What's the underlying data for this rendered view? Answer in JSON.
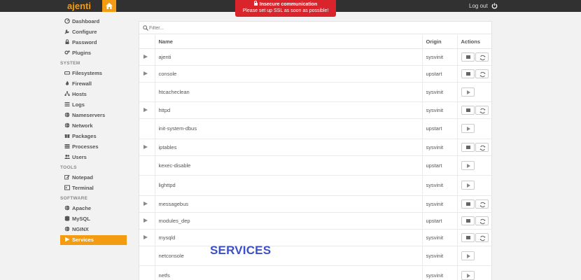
{
  "app": {
    "brand": "ajenti",
    "logout_label": "Log out"
  },
  "alert": {
    "title": "Insecure communication",
    "message": "Please set up SSL as soon as possible!"
  },
  "sidebar": {
    "top_items": [
      {
        "label": "Dashboard",
        "icon": "dashboard-icon"
      },
      {
        "label": "Configure",
        "icon": "wrench-icon"
      },
      {
        "label": "Password",
        "icon": "lock-icon"
      },
      {
        "label": "Plugins",
        "icon": "cogs-icon"
      }
    ],
    "sections": [
      {
        "title": "SYSTEM",
        "items": [
          {
            "label": "Filesystems",
            "icon": "hdd-icon"
          },
          {
            "label": "Firewall",
            "icon": "fire-icon"
          },
          {
            "label": "Hosts",
            "icon": "sitemap-icon"
          },
          {
            "label": "Logs",
            "icon": "list-icon"
          },
          {
            "label": "Nameservers",
            "icon": "globe-icon"
          },
          {
            "label": "Network",
            "icon": "globe-icon"
          },
          {
            "label": "Packages",
            "icon": "gift-icon"
          },
          {
            "label": "Processes",
            "icon": "tasks-icon"
          },
          {
            "label": "Users",
            "icon": "users-icon"
          }
        ]
      },
      {
        "title": "TOOLS",
        "items": [
          {
            "label": "Notepad",
            "icon": "edit-icon"
          },
          {
            "label": "Terminal",
            "icon": "terminal-icon"
          }
        ]
      },
      {
        "title": "SOFTWARE",
        "items": [
          {
            "label": "Apache",
            "icon": "globe-icon"
          },
          {
            "label": "MySQL",
            "icon": "database-icon"
          },
          {
            "label": "NGINX",
            "icon": "globe-icon"
          },
          {
            "label": "Services",
            "icon": "play-icon",
            "active": true
          }
        ]
      }
    ]
  },
  "filter": {
    "placeholder": "Filter..."
  },
  "table": {
    "headers": {
      "name": "Name",
      "origin": "Origin",
      "actions": "Actions"
    },
    "rows": [
      {
        "name": "ajenti",
        "origin": "sysvinit",
        "running": true
      },
      {
        "name": "console",
        "origin": "upstart",
        "running": true
      },
      {
        "name": "htcacheclean",
        "origin": "sysvinit",
        "running": false
      },
      {
        "name": "httpd",
        "origin": "sysvinit",
        "running": true
      },
      {
        "name": "init-system-dbus",
        "origin": "upstart",
        "running": false
      },
      {
        "name": "iptables",
        "origin": "sysvinit",
        "running": true
      },
      {
        "name": "kexec-disable",
        "origin": "upstart",
        "running": false
      },
      {
        "name": "lighttpd",
        "origin": "sysvinit",
        "running": false
      },
      {
        "name": "messagebus",
        "origin": "sysvinit",
        "running": true
      },
      {
        "name": "modules_dep",
        "origin": "upstart",
        "running": true
      },
      {
        "name": "mysqld",
        "origin": "sysvinit",
        "running": true
      },
      {
        "name": "netconsole",
        "origin": "sysvinit",
        "running": false
      },
      {
        "name": "netfs",
        "origin": "sysvinit",
        "running": false
      }
    ]
  },
  "overlay_text": "SERVICES",
  "colors": {
    "accent": "#f39c12",
    "topbar": "#313131",
    "alert": "#d9242c",
    "overlay": "#3b50c8"
  }
}
